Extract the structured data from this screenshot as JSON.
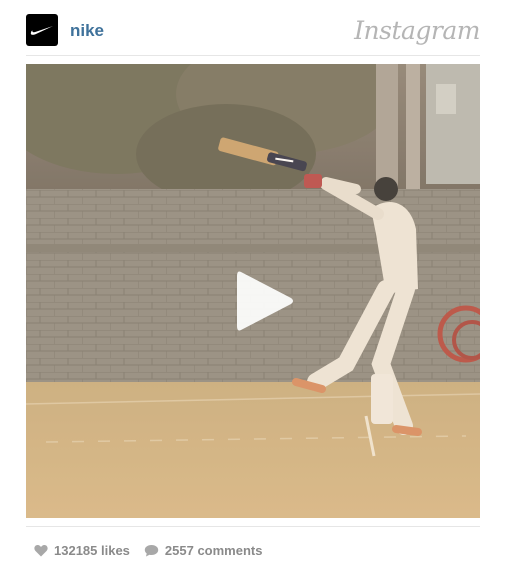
{
  "post": {
    "username": "nike",
    "brand": "Instagram"
  },
  "stats": {
    "likes_text": "132185 likes",
    "comments_text": "2557 comments"
  },
  "media": {
    "type": "video",
    "alt": "Cricket batsman swinging a Nike bat",
    "bat_brand_mark": "nike swoosh"
  },
  "colors": {
    "username": "#3f729b",
    "stat_text": "#8a8a8a",
    "divider": "#e6e6e6"
  },
  "icons": [
    "nike-logo-icon",
    "instagram-wordmark",
    "play-icon",
    "heart-icon",
    "comment-icon"
  ]
}
